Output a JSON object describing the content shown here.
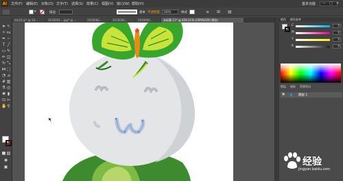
{
  "menubar": {
    "logo": "Ai",
    "items": [
      "文件(F)",
      "编辑(E)",
      "对象(O)",
      "文字(T)",
      "选择(S)",
      "效果(C)",
      "视图(V)",
      "窗口(W)",
      "帮助(H)"
    ],
    "workspace": "基本功能",
    "window_controls": [
      "—",
      "□",
      "✕"
    ]
  },
  "controlbar": {
    "stroke_label": "描边",
    "brush_label": "基本",
    "opacity_label": "不透明度",
    "opacity_value": "100%",
    "style_label": "样式"
  },
  "tabs": [
    {
      "label": "dm16.ai* @ 10...",
      "active": false
    },
    {
      "label": "2016091....jpg* @ ...",
      "active": false
    },
    {
      "label": "2016082...",
      "active": false
    },
    {
      "label": "2016090...",
      "active": false
    },
    {
      "label": "2016090...",
      "active": false
    },
    {
      "label": "未标题-11* @ 429.21% (CMYK/GPU 预览)",
      "active": true
    }
  ],
  "panels": {
    "tabs": [
      "颜色",
      "颜色参考"
    ],
    "sliders": [
      {
        "label": "C",
        "value": "0",
        "color": "#00aeef"
      },
      {
        "label": "M",
        "value": "0",
        "color": "#ec008c"
      },
      {
        "label": "Y",
        "value": "0",
        "color": "#fff200"
      },
      {
        "label": "K",
        "value": "0",
        "color": "#231f20"
      }
    ],
    "lower_tabs": [
      "图层",
      "画板",
      "资源导出"
    ],
    "layer_name": "图层 1"
  },
  "watermark": {
    "text": "经验",
    "url": "jingyan.baidu.com"
  },
  "colors": {
    "ui_dark": "#535353",
    "panel": "#424242",
    "accent_orange": "#ff9a00",
    "selection_blue": "#3f7ee8"
  }
}
